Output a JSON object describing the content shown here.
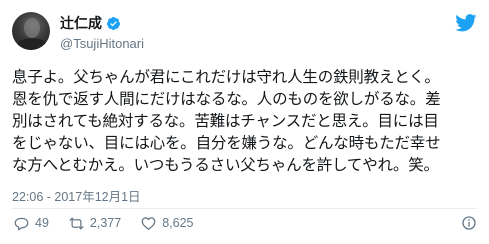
{
  "author": {
    "display_name": "辻仁成",
    "handle": "@TsujiHitonari",
    "verified": true
  },
  "tweet": {
    "text": "息子よ。父ちゃんが君にこれだけは守れ人生の鉄則教えとく。\n恩を仇で返す人間にだけはなるな。人のものを欲しがるな。差\n別はされても絶対するな。苦難はチャンスだと思え。目には目\nをじゃない、目には心を。自分を嫌うな。どんな時もただ幸せ\nな方へとむかえ。いつもうるさい父ちゃんを許してやれ。笑。",
    "timestamp": "22:06 - 2017年12月1日"
  },
  "actions": {
    "replies": "49",
    "retweets": "2,377",
    "likes": "8,625"
  },
  "colors": {
    "twitter_blue": "#1da1f2",
    "muted": "#657786",
    "text": "#14171a",
    "divider": "#e6ecf0"
  },
  "icons": {
    "verified": "verified-badge-icon",
    "brand": "twitter-bird-icon",
    "reply": "reply-icon",
    "retweet": "retweet-icon",
    "like": "heart-icon",
    "info": "info-icon"
  }
}
